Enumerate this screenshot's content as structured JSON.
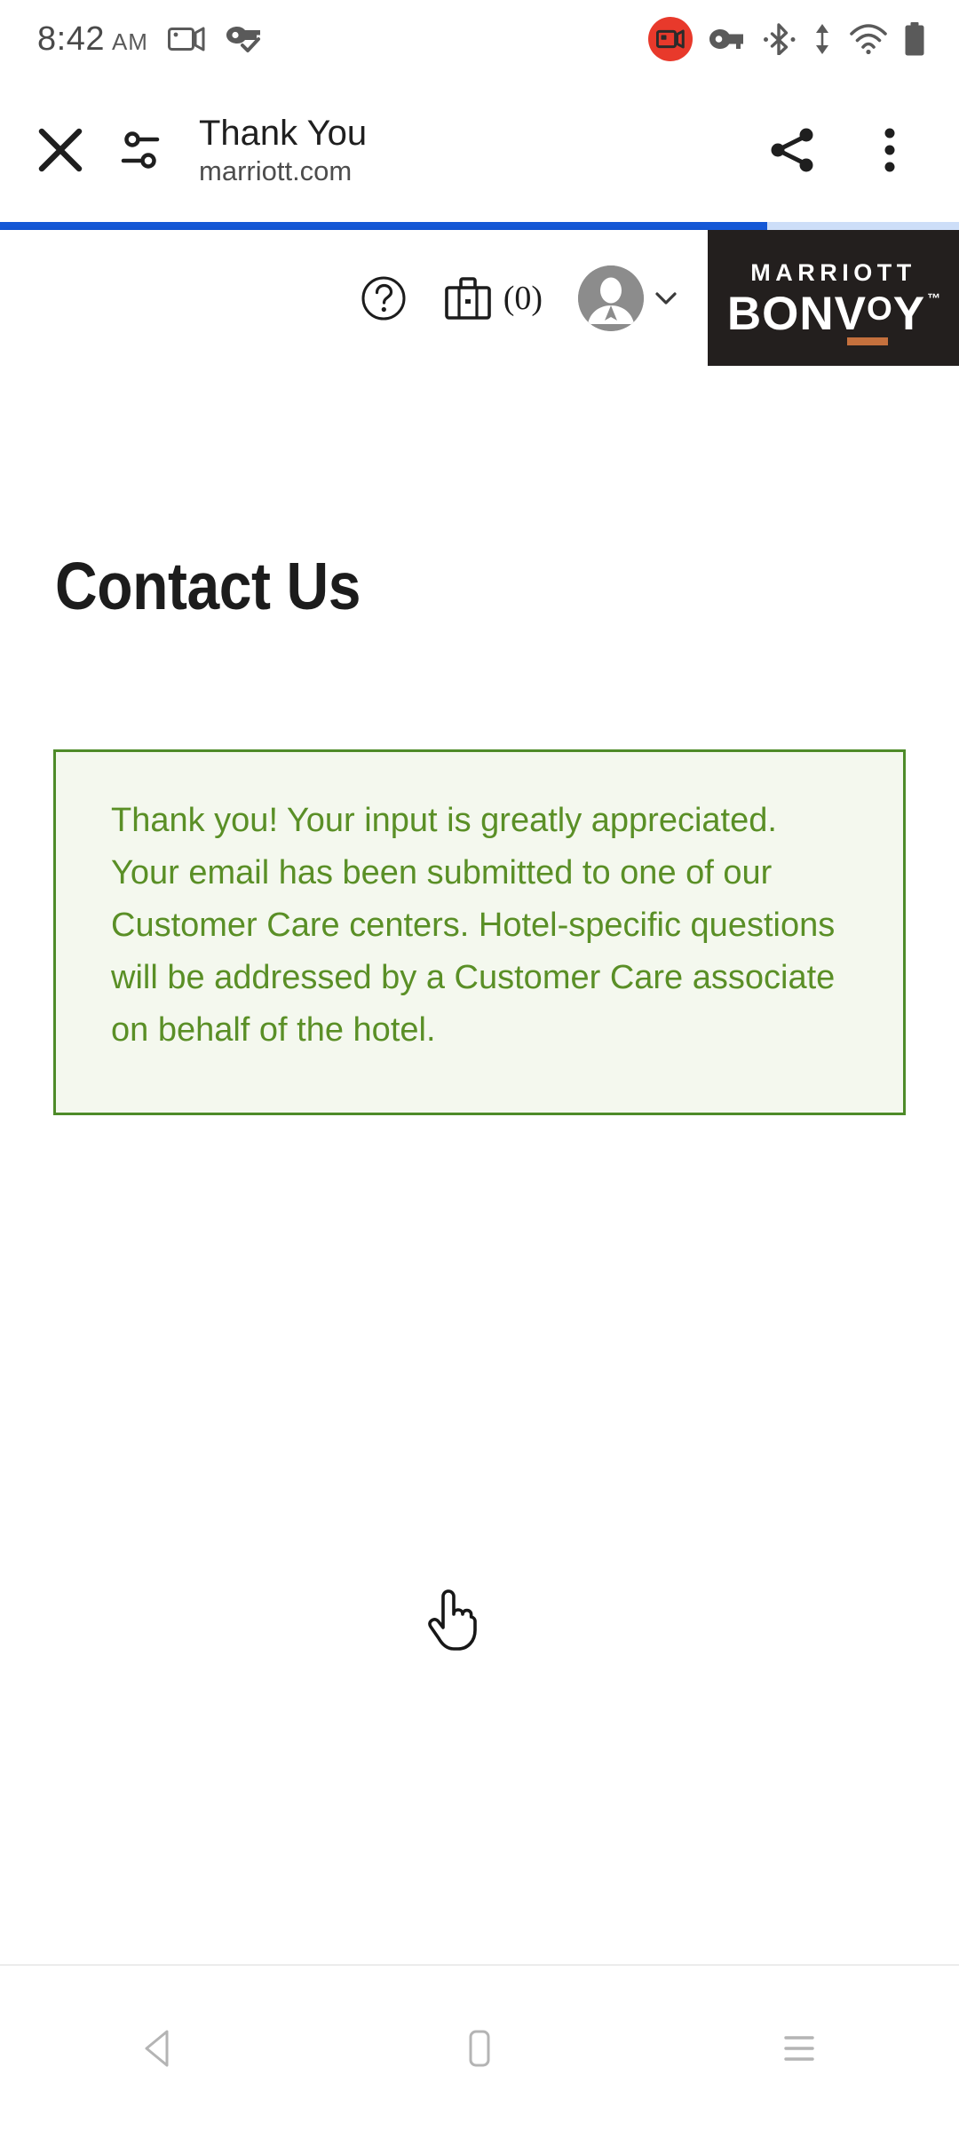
{
  "status_bar": {
    "time": "8:42",
    "meridiem": "AM",
    "left_icons": [
      "screen-record-icon",
      "vpn-key-check-icon"
    ],
    "right_icons": [
      "screen-recording-active-icon",
      "vpn-key-icon",
      "bluetooth-icon",
      "data-transfer-icon",
      "wifi-icon",
      "battery-icon"
    ]
  },
  "browser": {
    "close_label": "close-icon",
    "page_info_label": "page-info-icon",
    "title": "Thank You",
    "origin": "marriott.com",
    "share_label": "share-icon",
    "menu_label": "more-options-icon",
    "progress_percent": 80,
    "progress_color": "#1558d6"
  },
  "site_header": {
    "help_icon": "help-circle-icon",
    "trips_icon": "briefcase-icon",
    "trips_count": "(0)",
    "account_icon": "account-avatar-icon",
    "account_chevron": "chevron-down-icon",
    "logo": {
      "top": "MARRIOTT",
      "bottom_pre": "BONV",
      "bottom_o": "O",
      "bottom_post": "Y",
      "trademark": "™",
      "background": "#231f1e",
      "accent": "#c4703d"
    }
  },
  "page": {
    "title": "Contact Us",
    "notice": {
      "text": "Thank you! Your input is greatly appreciated. Your email has been submitted to one of our Customer Care centers. Hotel-specific questions will be addressed by a Customer Care associate on behalf of the hotel.",
      "border_color": "#4e8b29",
      "background_color": "#f4f8ee",
      "text_color": "#5a8f26"
    }
  },
  "cursor": {
    "type": "pointer-hand-cursor"
  },
  "nav_bar": {
    "back": "back-nav-icon",
    "home": "home-nav-icon",
    "recents": "recents-nav-icon"
  }
}
